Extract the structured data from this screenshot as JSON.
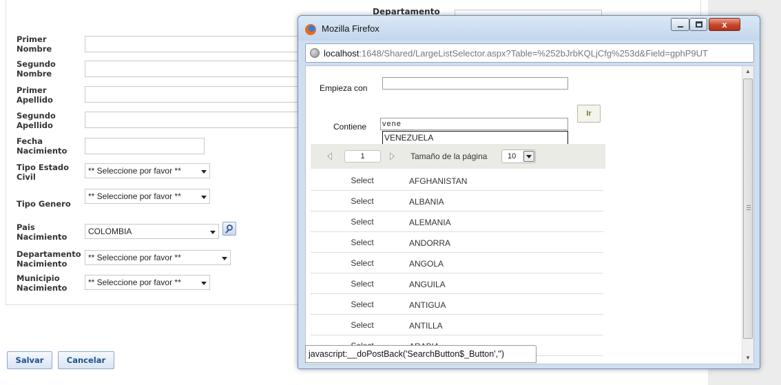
{
  "form": {
    "labels": {
      "primer_nombre": [
        "Primer",
        "Nombre"
      ],
      "segundo_nombre": [
        "Segundo",
        "Nombre"
      ],
      "primer_apellido": [
        "Primer",
        "Apellido"
      ],
      "segundo_apellido": [
        "Segundo",
        "Apellido"
      ],
      "fecha_nacimiento": [
        "Fecha",
        "Nacimiento"
      ],
      "tipo_estado_civil": [
        "Tipo Estado",
        "Civil"
      ],
      "tipo_genero": "Tipo Genero",
      "pais_nacimiento": [
        "Pais",
        "Nacimiento"
      ],
      "departamento_nacimiento": [
        "Departamento",
        "Nacimiento"
      ],
      "municipio_nacimiento": [
        "Municipio",
        "Nacimiento"
      ]
    },
    "selects": {
      "tipo_estado_civil": "** Seleccione por favor **",
      "tipo_genero": "** Seleccione por favor **",
      "pais_nacimiento": "COLOMBIA",
      "departamento_nacimiento": "** Seleccione por favor **",
      "municipio_nacimiento": "** Seleccione por favor **"
    },
    "behind_label": "Departamento",
    "buttons": {
      "save": "Salvar",
      "cancel": "Cancelar"
    }
  },
  "popup": {
    "title": "Mozilla Firefox",
    "url_host": "localhost",
    "url_rest": ":1648/Shared/LargeListSelector.aspx?Table=%252bJrbKQLjCfg%253d&Field=gphP9UT",
    "close_glyph": "x",
    "starts_with_label": "Empieza con",
    "starts_with_value": "",
    "contains_label": "Contiene",
    "contains_value": "vene",
    "search_button": "Ir",
    "autocomplete_suggestion": "VENEZUELA",
    "pager": {
      "page": "1",
      "page_size_label": "Tamaño de la página",
      "page_size": "10"
    },
    "rows": [
      {
        "action": "Select",
        "country": "AFGHANISTAN"
      },
      {
        "action": "Select",
        "country": "ALBANIA"
      },
      {
        "action": "Select",
        "country": "ALEMANIA"
      },
      {
        "action": "Select",
        "country": "ANDORRA"
      },
      {
        "action": "Select",
        "country": "ANGOLA"
      },
      {
        "action": "Select",
        "country": "ANGUILA"
      },
      {
        "action": "Select",
        "country": "ANTIGUA"
      },
      {
        "action": "Select",
        "country": "ANTILLA"
      },
      {
        "action": "Select",
        "country": "ARABIA"
      }
    ],
    "status_text": "javascript:__doPostBack('SearchButton$_Button','')"
  }
}
